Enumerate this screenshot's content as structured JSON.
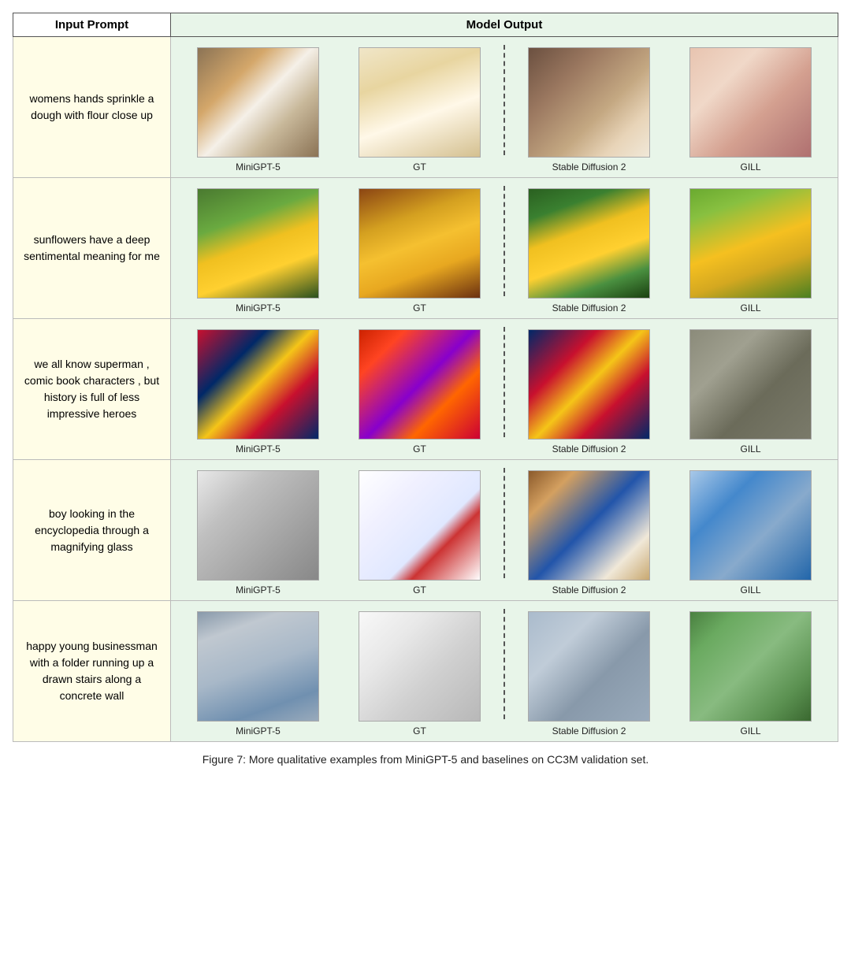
{
  "header": {
    "input_prompt": "Input Prompt",
    "model_output": "Model Output"
  },
  "labels": {
    "minigpt5": "MiniGPT-5",
    "gt": "GT",
    "stable_diffusion": "Stable Diffusion 2",
    "gill": "GILL"
  },
  "rows": [
    {
      "prompt": "womens hands sprinkle a dough with flour close up",
      "images": [
        "img-flour-minigpt",
        "img-flour-gt",
        "img-flour-sd",
        "img-flour-gill"
      ]
    },
    {
      "prompt": "sunflowers have a deep sentimental meaning for me",
      "images": [
        "img-sunflower-minigpt",
        "img-sunflower-gt",
        "img-sunflower-sd",
        "img-sunflower-gill"
      ]
    },
    {
      "prompt": "we all know superman , comic book characters , but history is full of less impressive heroes",
      "images": [
        "img-superman-minigpt",
        "img-superman-gt",
        "img-superman-sd",
        "img-superman-gill"
      ]
    },
    {
      "prompt": "boy looking in the encyclopedia through a magnifying glass",
      "images": [
        "img-boy-minigpt",
        "img-boy-gt",
        "img-boy-sd",
        "img-boy-gill"
      ]
    },
    {
      "prompt": "happy young businessman with a folder running up a drawn stairs along a concrete wall",
      "images": [
        "img-biz-minigpt",
        "img-biz-gt",
        "img-biz-sd",
        "img-biz-gill"
      ]
    }
  ],
  "caption": "Figure 7: More qualitative examples from MiniGPT-5 and baselines on CC3M validation set."
}
